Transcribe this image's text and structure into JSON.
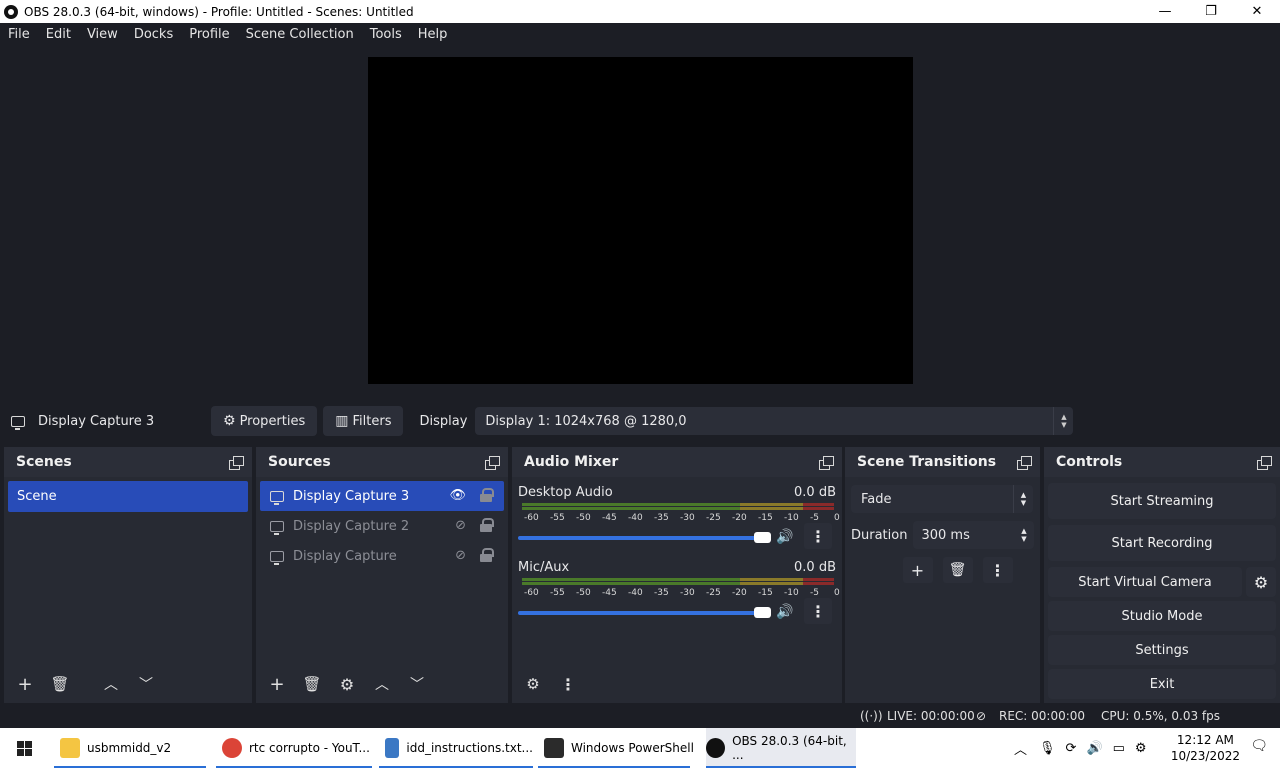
{
  "window": {
    "title": "OBS 28.0.3 (64-bit, windows) - Profile: Untitled - Scenes: Untitled",
    "minimize": "—",
    "maximize": "❐",
    "close": "✕"
  },
  "menu": [
    "File",
    "Edit",
    "View",
    "Docks",
    "Profile",
    "Scene Collection",
    "Tools",
    "Help"
  ],
  "source_toolbar": {
    "current_source": "Display Capture 3",
    "properties_label": "Properties",
    "filters_label": "Filters",
    "display_label": "Display",
    "display_value": "Display 1: 1024x768 @ 1280,0"
  },
  "docks": {
    "scenes": {
      "title": "Scenes",
      "items": [
        "Scene"
      ]
    },
    "sources": {
      "title": "Sources",
      "items": [
        {
          "label": "Display Capture 3",
          "visible": true
        },
        {
          "label": "Display Capture 2",
          "visible": false
        },
        {
          "label": "Display Capture",
          "visible": false
        }
      ]
    },
    "audio_mixer": {
      "title": "Audio Mixer",
      "ticks": [
        "-60",
        "-55",
        "-50",
        "-45",
        "-40",
        "-35",
        "-30",
        "-25",
        "-20",
        "-15",
        "-10",
        "-5",
        "0"
      ],
      "channels": [
        {
          "name": "Desktop Audio",
          "level": "0.0 dB"
        },
        {
          "name": "Mic/Aux",
          "level": "0.0 dB"
        }
      ]
    },
    "transitions": {
      "title": "Scene Transitions",
      "selected": "Fade",
      "duration_label": "Duration",
      "duration_value": "300 ms"
    },
    "controls": {
      "title": "Controls",
      "start_streaming": "Start Streaming",
      "start_recording": "Start Recording",
      "start_virtual_camera": "Start Virtual Camera",
      "studio_mode": "Studio Mode",
      "settings": "Settings",
      "exit": "Exit"
    }
  },
  "status": {
    "live": "LIVE: 00:00:00",
    "rec": "REC: 00:00:00",
    "cpu": "CPU: 0.5%, 0.03 fps"
  },
  "taskbar": {
    "items": [
      {
        "label": "usbmmidd_v2",
        "icon": "folder-icon",
        "color": "#f4c542"
      },
      {
        "label": "rtc corrupto - YouT...",
        "icon": "chrome-icon",
        "color": "#db4437"
      },
      {
        "label": "idd_instructions.txt...",
        "icon": "notepad-icon",
        "color": "#3b78c4"
      },
      {
        "label": "Windows PowerShell",
        "icon": "powershell-icon",
        "color": "#2b2b2b"
      },
      {
        "label": "OBS 28.0.3 (64-bit, ...",
        "icon": "obs-icon",
        "color": "#111111"
      }
    ],
    "time": "12:12 AM",
    "date": "10/23/2022"
  },
  "colors": {
    "accent": "#284cb8",
    "panel": "#272a33",
    "background": "#1c1e25",
    "fader": "#3471e0"
  }
}
